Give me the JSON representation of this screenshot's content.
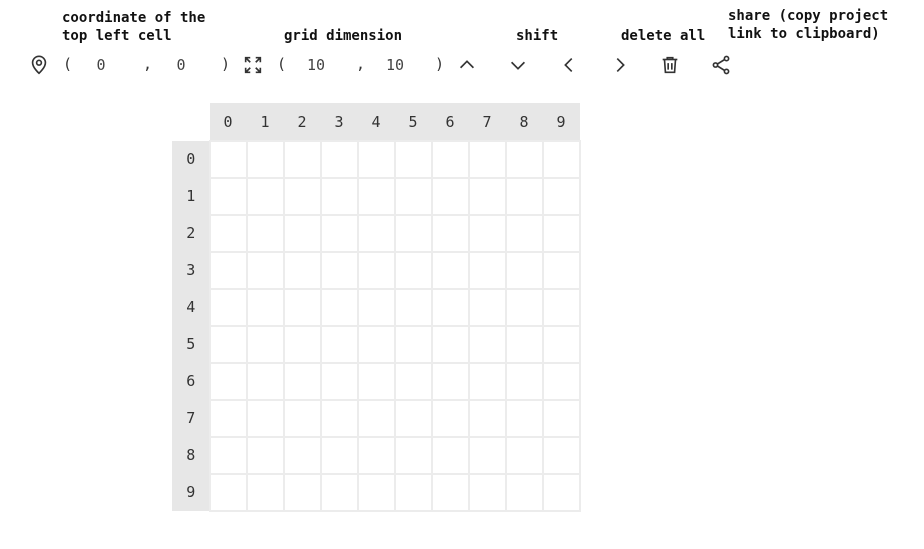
{
  "labels": {
    "coordinate_line1": "coordinate of the",
    "coordinate_line2": "top left cell",
    "grid_dimension": "grid dimension",
    "shift": "shift",
    "delete_all": "delete all",
    "share_line1": "share (copy project",
    "share_line2": "link to clipboard)"
  },
  "toolbar": {
    "open_paren": "(",
    "close_paren": ")",
    "comma": ",",
    "coord_x": "0",
    "coord_y": "0",
    "dim_w": "10",
    "dim_h": "10",
    "icons": {
      "location": "map-pin-icon",
      "resize": "expand-icon",
      "up": "chevron-up-icon",
      "down": "chevron-down-icon",
      "left": "chevron-left-icon",
      "right": "chevron-right-icon",
      "delete": "trash-icon",
      "share": "share-icon"
    }
  },
  "grid": {
    "col_headers": [
      "0",
      "1",
      "2",
      "3",
      "4",
      "5",
      "6",
      "7",
      "8",
      "9"
    ],
    "row_headers": [
      "0",
      "1",
      "2",
      "3",
      "4",
      "5",
      "6",
      "7",
      "8",
      "9"
    ]
  },
  "colors": {
    "header_bg": "#e7e7e7",
    "cell_border": "#ececec"
  }
}
